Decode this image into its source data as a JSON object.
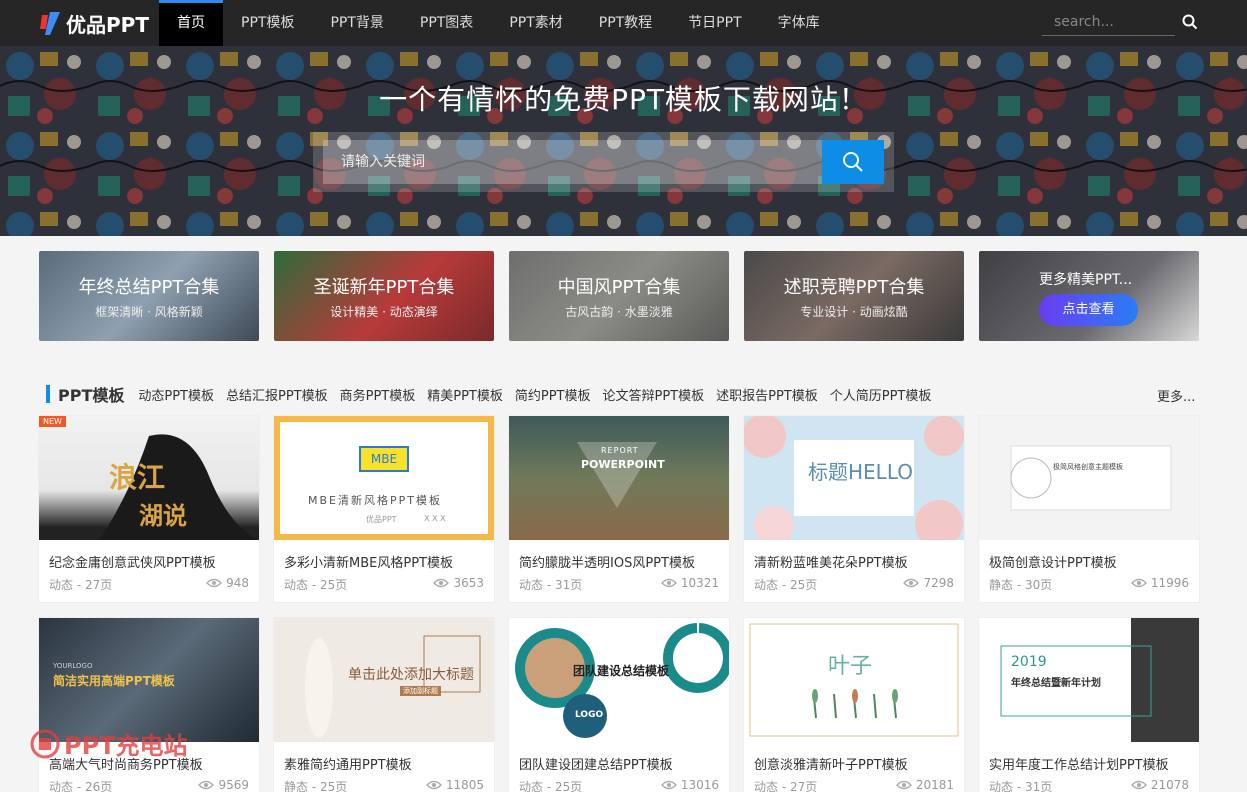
{
  "nav": {
    "logo_text": "优品PPT",
    "items": [
      "首页",
      "PPT模板",
      "PPT背景",
      "PPT图表",
      "PPT素材",
      "PPT教程",
      "节日PPT",
      "字体库"
    ],
    "search_placeholder": "search..."
  },
  "banner": {
    "title": "一个有情怀的免费PPT模板下载网站！",
    "search_placeholder": "请输入关键词"
  },
  "collections": [
    {
      "title": "年终总结PPT合集",
      "subtitle": "框架清晰 · 风格新颖"
    },
    {
      "title": "圣诞新年PPT合集",
      "subtitle": "设计精美 · 动态演绎"
    },
    {
      "title": "中国风PPT合集",
      "subtitle": "古风古韵 · 水墨淡雅"
    },
    {
      "title": "述职竞聘PPT合集",
      "subtitle": "专业设计 · 动画炫酷"
    },
    {
      "title": "更多精美PPT...",
      "button": "点击查看"
    }
  ],
  "section": {
    "title": "PPT模板",
    "categories": [
      "动态PPT模板",
      "总结汇报PPT模板",
      "商务PPT模板",
      "精美PPT模板",
      "简约PPT模板",
      "论文答辩PPT模板",
      "述职报告PPT模板",
      "个人简历PPT模板"
    ],
    "more": "更多..."
  },
  "cards": [
    {
      "name": "纪念金庸创意武侠风PPT模板",
      "meta": "动态 - 27页",
      "views": "948",
      "badge": "NEW",
      "thumb_text": [
        "浪江",
        "湖说"
      ]
    },
    {
      "name": "多彩小清新MBE风格PPT模板",
      "meta": "动态 - 25页",
      "views": "3653",
      "thumb_text": [
        "MBE",
        "MBE清新风格PPT模板",
        "优品PPT",
        "X X X"
      ]
    },
    {
      "name": "简约朦胧半透明IOS风PPT模板",
      "meta": "动态 - 31页",
      "views": "10321",
      "thumb_text": [
        "REPORT",
        "POWERPOINT"
      ]
    },
    {
      "name": "清新粉蓝唯美花朵PPT模板",
      "meta": "动态 - 25页",
      "views": "7298",
      "thumb_text": [
        "标题HELLO"
      ]
    },
    {
      "name": "极简创意设计PPT模板",
      "meta": "静态 - 30页",
      "views": "11996",
      "thumb_text": [
        "极简风格创意主题模板"
      ]
    },
    {
      "name": "高端大气时尚商务PPT模板",
      "meta": "动态 - 26页",
      "views": "9569",
      "thumb_text": [
        "YOURLOGO",
        "简洁实用高端PPT模板"
      ]
    },
    {
      "name": "素雅简约通用PPT模板",
      "meta": "静态 - 25页",
      "views": "11805",
      "thumb_text": [
        "单击此处添加大标题",
        "添加副标题"
      ]
    },
    {
      "name": "团队建设团建总结PPT模板",
      "meta": "动态 - 25页",
      "views": "13016",
      "thumb_text": [
        "团队建设总结模板",
        "LOGO"
      ]
    },
    {
      "name": "创意淡雅清新叶子PPT模板",
      "meta": "动态 - 27页",
      "views": "20181",
      "thumb_text": [
        "叶子"
      ]
    },
    {
      "name": "实用年度工作总结计划PPT模板",
      "meta": "动态 - 31页",
      "views": "21078",
      "thumb_text": [
        "2019",
        "年终总结暨新年计划"
      ]
    }
  ],
  "watermark": "PPT充电站",
  "colors": {
    "accent": "#0d8de5",
    "nav_bg": "#262626",
    "new_badge": "#f05a28"
  }
}
